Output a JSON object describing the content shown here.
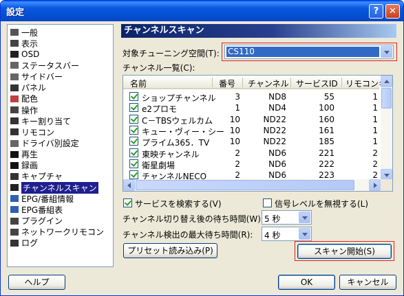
{
  "window": {
    "title": "設定",
    "help_glyph": "?",
    "close_glyph": "✕"
  },
  "sidebar": {
    "items": [
      {
        "label": "一般",
        "icon": "general-icon"
      },
      {
        "label": "表示",
        "icon": "display-icon"
      },
      {
        "label": "OSD",
        "icon": "osd-icon"
      },
      {
        "label": "ステータスバー",
        "icon": "statusbar-icon"
      },
      {
        "label": "サイドバー",
        "icon": "sidebar-icon"
      },
      {
        "label": "パネル",
        "icon": "panel-icon"
      },
      {
        "label": "配色",
        "icon": "palette-icon"
      },
      {
        "label": "操作",
        "icon": "mouse-icon"
      },
      {
        "label": "キー割り当て",
        "icon": "keyboard-icon"
      },
      {
        "label": "リモコン",
        "icon": "remote-icon"
      },
      {
        "label": "ドライバ別設定",
        "icon": "driver-icon"
      },
      {
        "label": "再生",
        "icon": "play-icon"
      },
      {
        "label": "録画",
        "icon": "record-icon"
      },
      {
        "label": "キャプチャ",
        "icon": "camera-icon"
      },
      {
        "label": "チャンネルスキャン",
        "icon": "scan-icon",
        "selected": true
      },
      {
        "label": "EPG/番組情報",
        "icon": "epg-icon"
      },
      {
        "label": "EPG番組表",
        "icon": "program-guide-icon"
      },
      {
        "label": "プラグイン",
        "icon": "plugin-icon"
      },
      {
        "label": "ネットワークリモコン",
        "icon": "network-icon"
      },
      {
        "label": "ログ",
        "icon": "log-icon"
      }
    ]
  },
  "panel": {
    "title": "チャンネルスキャン",
    "tuning_space_label": "対象チューニング空間(T):",
    "tuning_space_value": "CS110",
    "channel_list_label": "チャンネル一覧(C):",
    "columns": [
      "名前",
      "番号",
      "チャンネル",
      "サービスID",
      "リモコンキ"
    ],
    "rows": [
      {
        "name": "ショップチャンネル",
        "num": "3",
        "ch": "ND8",
        "sid": "55",
        "rc": "1"
      },
      {
        "name": "e2プロモ",
        "num": "1",
        "ch": "ND4",
        "sid": "100",
        "rc": "1"
      },
      {
        "name": "C－TBSウェルカム",
        "num": "10",
        "ch": "ND22",
        "sid": "160",
        "rc": "1"
      },
      {
        "name": "キュー・ヴィー・シー",
        "num": "10",
        "ch": "ND22",
        "sid": "161",
        "rc": "1"
      },
      {
        "name": "プライム365．TV",
        "num": "10",
        "ch": "ND22",
        "sid": "185",
        "rc": "1"
      },
      {
        "name": "東映チャンネル",
        "num": "2",
        "ch": "ND6",
        "sid": "221",
        "rc": "2"
      },
      {
        "name": "衛星劇場",
        "num": "2",
        "ch": "ND6",
        "sid": "222",
        "rc": "2"
      },
      {
        "name": "チャンネルNECO",
        "num": "2",
        "ch": "ND6",
        "sid": "223",
        "rc": "2"
      }
    ],
    "search_services_label": "サービスを検索する(V)",
    "ignore_signal_label": "信号レベルを無視する(L)",
    "switch_wait_label": "チャンネル切り替え後の待ち時間(W):",
    "switch_wait_value": "5 秒",
    "detect_wait_label": "チャンネル検出の最大待ち時間(R):",
    "detect_wait_value": "4 秒",
    "preset_button": "プリセット読み込み(P)",
    "scan_button": "スキャン開始(S)"
  },
  "footer": {
    "help_button": "ヘルプ",
    "ok_button": "OK",
    "cancel_button": "キャンセル"
  },
  "colors": {
    "selected_bg": "#1f1f8f",
    "header_grad_start": "#0a246a",
    "highlight_red": "#e02020"
  }
}
